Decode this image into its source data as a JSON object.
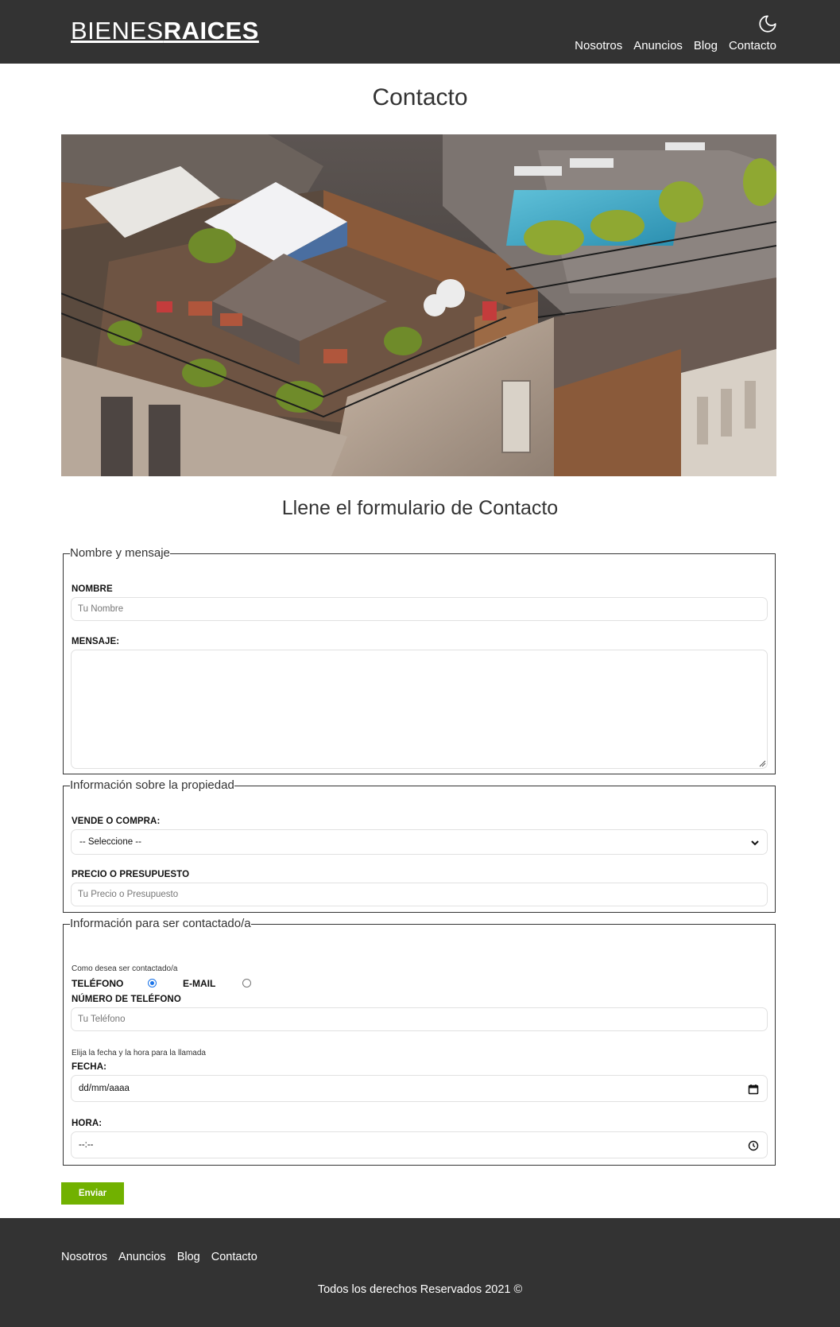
{
  "header": {
    "logo_light": "BIENES",
    "logo_bold": "RAICES",
    "dark_mode_icon": "moon-icon",
    "nav": [
      "Nosotros",
      "Anuncios",
      "Blog",
      "Contacto"
    ]
  },
  "main": {
    "title": "Contacto",
    "form_title": "Llene el formulario de Contacto"
  },
  "form": {
    "section1": {
      "legend": "Nombre y mensaje",
      "name_label": "Nombre",
      "name_placeholder": "Tu Nombre",
      "message_label": "Mensaje:"
    },
    "section2": {
      "legend": "Información sobre la propiedad",
      "type_label": "Vende o Compra:",
      "type_selected": "-- Seleccione --",
      "price_label": "Precio o Presupuesto",
      "price_placeholder": "Tu Precio o Presupuesto"
    },
    "section3": {
      "legend": "Información para ser contactado/a",
      "contact_hint": "Como desea ser contactado/a",
      "radio_phone": "Teléfono",
      "radio_email": "E-mail",
      "selected_contact": "Teléfono",
      "phone_label": "Número de Teléfono",
      "phone_placeholder": "Tu Teléfono",
      "datetime_hint": "Elija la fecha y la hora para la llamada",
      "date_label": "Fecha:",
      "date_value": "dd/mm/aaaa",
      "time_label": "Hora:",
      "time_value": "--:--"
    },
    "submit_label": "Enviar"
  },
  "footer": {
    "nav": [
      "Nosotros",
      "Anuncios",
      "Blog",
      "Contacto"
    ],
    "copyright": "Todos los derechos Reservados 2021 ©"
  },
  "colors": {
    "header_bg": "#333333",
    "accent_green": "#71b100",
    "radio_blue": "#1a73e8"
  }
}
